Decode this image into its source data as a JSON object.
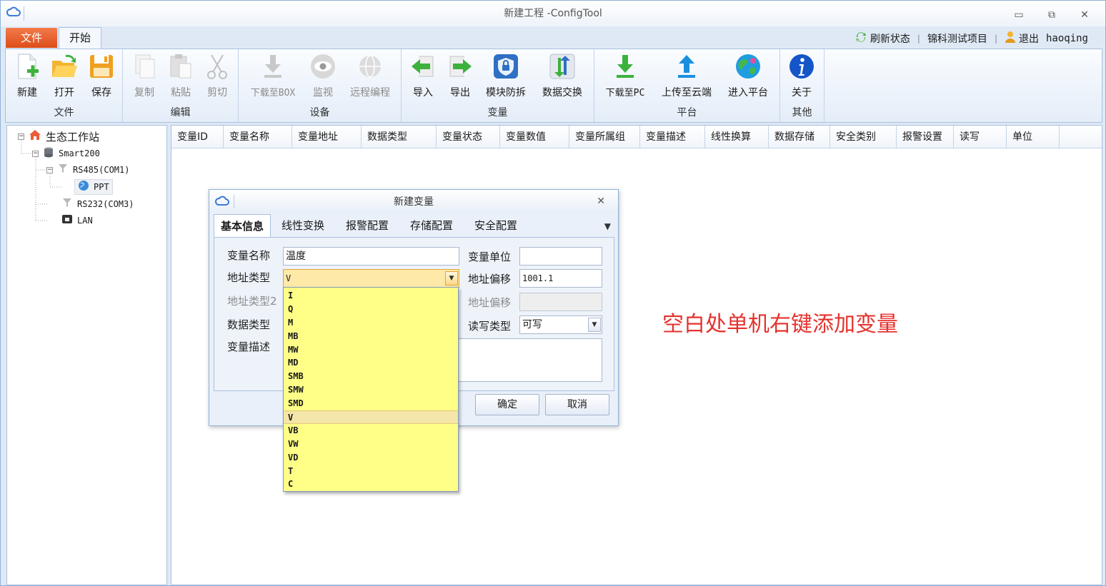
{
  "window": {
    "title": "新建工程 -ConfigTool"
  },
  "menu": {
    "file_tab": "文件",
    "home_tab": "开始",
    "refresh": "刷新状态",
    "project": "锦科测试项目",
    "logout": "退出",
    "user": "haoqing"
  },
  "ribbon": {
    "groups": {
      "file": "文件",
      "edit": "编辑",
      "device": "设备",
      "variable": "变量",
      "platform": "平台",
      "other": "其他"
    },
    "buttons": {
      "new": "新建",
      "open": "打开",
      "save": "保存",
      "copy": "复制",
      "paste": "粘贴",
      "cut": "剪切",
      "download_box": "下载至BOX",
      "monitor": "监视",
      "remote_program": "远程编程",
      "import": "导入",
      "export": "导出",
      "module_protect": "模块防拆",
      "data_exchange": "数据交换",
      "download_pc": "下载至PC",
      "upload_cloud": "上传至云端",
      "enter_platform": "进入平台",
      "about": "关于"
    }
  },
  "tree": {
    "root": "生态工作站",
    "device": "Smart200",
    "port1": "RS485(COM1)",
    "ppt": "PPT",
    "port2": "RS232(COM3)",
    "lan": "LAN"
  },
  "grid": {
    "columns": [
      "变量ID",
      "变量名称",
      "变量地址",
      "数据类型",
      "变量状态",
      "变量数值",
      "变量所属组",
      "变量描述",
      "线性换算",
      "数据存储",
      "安全类别",
      "报警设置",
      "读写",
      "单位"
    ]
  },
  "hint": "空白处单机右键添加变量",
  "dialog": {
    "title": "新建变量",
    "tabs": [
      "基本信息",
      "线性变换",
      "报警配置",
      "存储配置",
      "安全配置"
    ],
    "fields": {
      "var_name_label": "变量名称",
      "var_name_value": "温度",
      "addr_type_label": "地址类型",
      "addr_type_value": "V",
      "addr_type2_label": "地址类型2",
      "data_type_label": "数据类型",
      "desc_label": "变量描述",
      "unit_label": "变量单位",
      "unit_value": "",
      "offset_label": "地址偏移",
      "offset_value": "1001.1",
      "offset2_label": "地址偏移",
      "rw_label": "读写类型",
      "rw_value": "可写"
    },
    "ok": "确定",
    "cancel": "取消"
  },
  "dropdown": {
    "options": [
      "I",
      "Q",
      "M",
      "MB",
      "MW",
      "MD",
      "SMB",
      "SMW",
      "SMD",
      "V",
      "VB",
      "VW",
      "VD",
      "T",
      "C"
    ],
    "selected": "V"
  },
  "colors": {
    "accent": "#dd4d1a",
    "hint": "#e5322d",
    "dropdown_bg": "#ffff88"
  }
}
